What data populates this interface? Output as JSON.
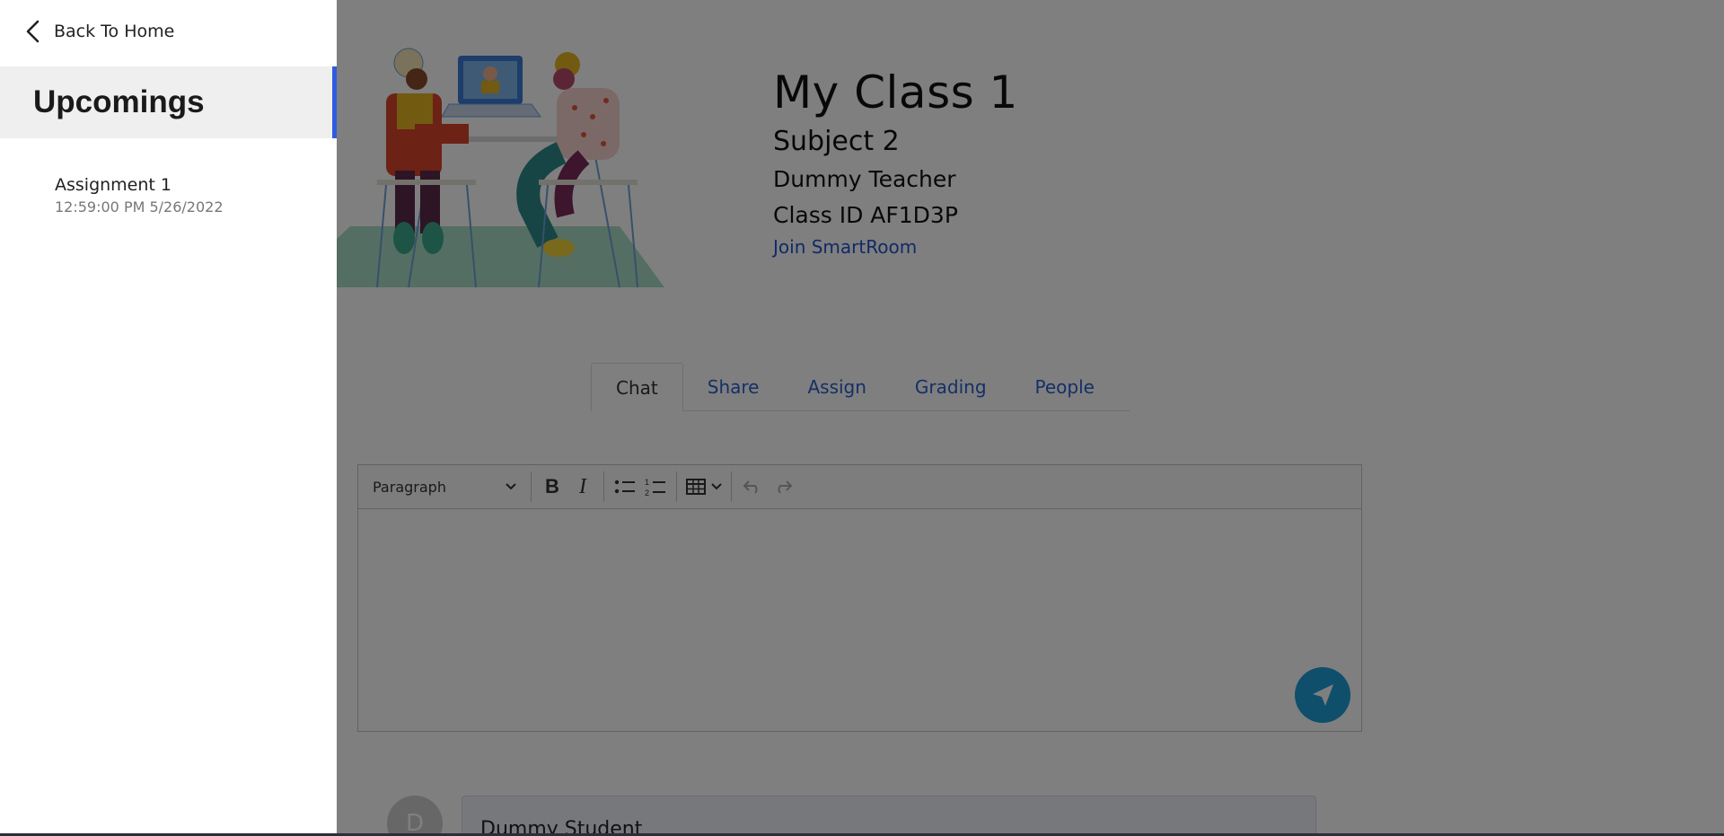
{
  "drawer": {
    "back_label": "Back To Home",
    "section_title": "Upcomings",
    "items": [
      {
        "title": "Assignment 1",
        "due": "12:59:00 PM 5/26/2022"
      }
    ]
  },
  "class": {
    "title": "My Class 1",
    "subject": "Subject 2",
    "teacher": "Dummy Teacher",
    "class_id": "Class ID AF1D3P",
    "join_label": "Join SmartRoom"
  },
  "tabs": [
    {
      "label": "Chat",
      "active": true
    },
    {
      "label": "Share"
    },
    {
      "label": "Assign"
    },
    {
      "label": "Grading"
    },
    {
      "label": "People"
    }
  ],
  "editor": {
    "format_select": "Paragraph",
    "toolbar_icons": [
      "bold-icon",
      "italic-icon",
      "bulleted-list-icon",
      "numbered-list-icon",
      "table-icon",
      "undo-icon",
      "redo-icon"
    ]
  },
  "post": {
    "avatar_initial": "D",
    "author": "Dummy Student"
  },
  "colors": {
    "accent": "#2f5ce0",
    "link": "#2b5fcf",
    "send_button": "#1e9fd6",
    "overlay": "rgba(0,0,0,0.5)"
  }
}
